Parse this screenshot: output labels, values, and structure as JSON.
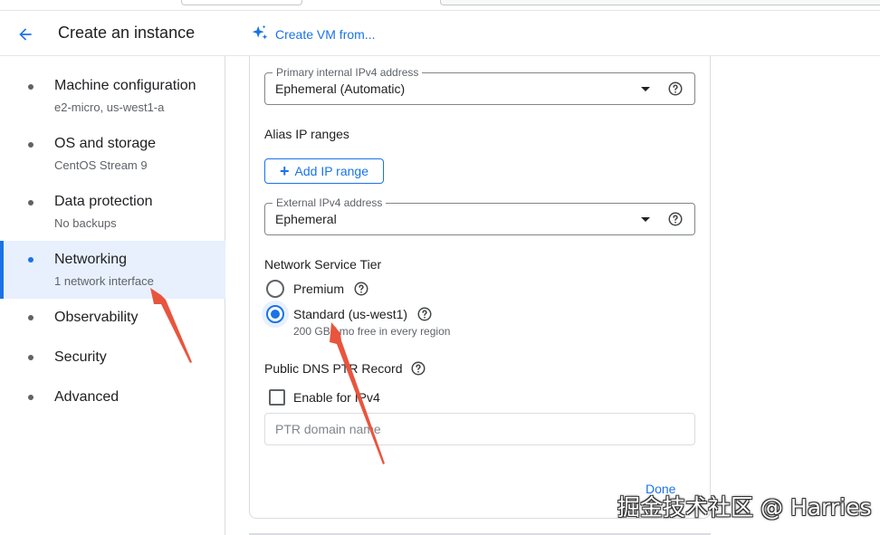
{
  "header": {
    "title": "Create an instance",
    "create_vm_label": "Create VM from..."
  },
  "sidebar": {
    "items": [
      {
        "label": "Machine configuration",
        "sub": "e2-micro, us-west1-a"
      },
      {
        "label": "OS and storage",
        "sub": "CentOS Stream 9"
      },
      {
        "label": "Data protection",
        "sub": "No backups"
      },
      {
        "label": "Networking",
        "sub": "1 network interface",
        "active": true
      },
      {
        "label": "Observability",
        "sub": ""
      },
      {
        "label": "Security",
        "sub": ""
      },
      {
        "label": "Advanced",
        "sub": ""
      }
    ]
  },
  "form": {
    "internal_ip": {
      "label": "Primary internal IPv4 address",
      "value": "Ephemeral (Automatic)"
    },
    "alias_heading": "Alias IP ranges",
    "add_ip_label": "Add IP range",
    "external_ip": {
      "label": "External IPv4 address",
      "value": "Ephemeral"
    },
    "tier_heading": "Network Service Tier",
    "tier_options": [
      {
        "label": "Premium",
        "selected": false
      },
      {
        "label": "Standard (us-west1)",
        "selected": true,
        "hint": "200 GB / mo free in every region"
      }
    ],
    "dns_heading": "Public DNS PTR Record",
    "enable_ipv4_label": "Enable for IPv4",
    "ptr_placeholder": "PTR domain name",
    "done_label": "Done"
  },
  "watermark": "掘金技术社区 @ Harries",
  "colors": {
    "accent": "#1a73e8",
    "active_bg": "#e8f0fe",
    "annotation_arrow": "#e8553e"
  },
  "icons": {
    "back": "arrow-back-icon",
    "sparkle": "sparkle-icon",
    "help": "help-circle-icon",
    "caret": "caret-down-icon",
    "add": "plus-icon"
  }
}
